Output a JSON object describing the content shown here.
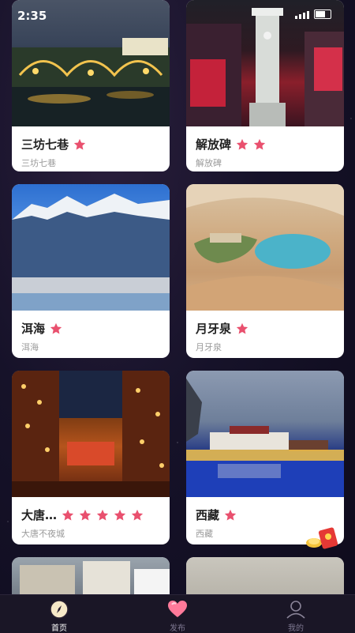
{
  "status_bar": {
    "time": "2:35"
  },
  "cards": [
    {
      "title": "三坊七巷",
      "subtitle": "三坊七巷",
      "stars": 1
    },
    {
      "title": "解放碑",
      "subtitle": "解放碑",
      "stars": 2
    },
    {
      "title": "洱海",
      "subtitle": "洱海",
      "stars": 1
    },
    {
      "title": "月牙泉",
      "subtitle": "月牙泉",
      "stars": 1
    },
    {
      "title": "大唐…",
      "subtitle": "大唐不夜城",
      "stars": 5
    },
    {
      "title": "西藏",
      "subtitle": "西藏",
      "stars": 1
    }
  ],
  "tabbar": {
    "items": [
      {
        "label": "首页",
        "icon": "compass-icon",
        "active": true
      },
      {
        "label": "发布",
        "icon": "heart-icon",
        "active": false
      },
      {
        "label": "我的",
        "icon": "user-icon",
        "active": false
      }
    ]
  },
  "colors": {
    "star": "#e9506e",
    "tab_active": "#ffffff",
    "tab_inactive": "#7d7790",
    "background": "#161229"
  }
}
